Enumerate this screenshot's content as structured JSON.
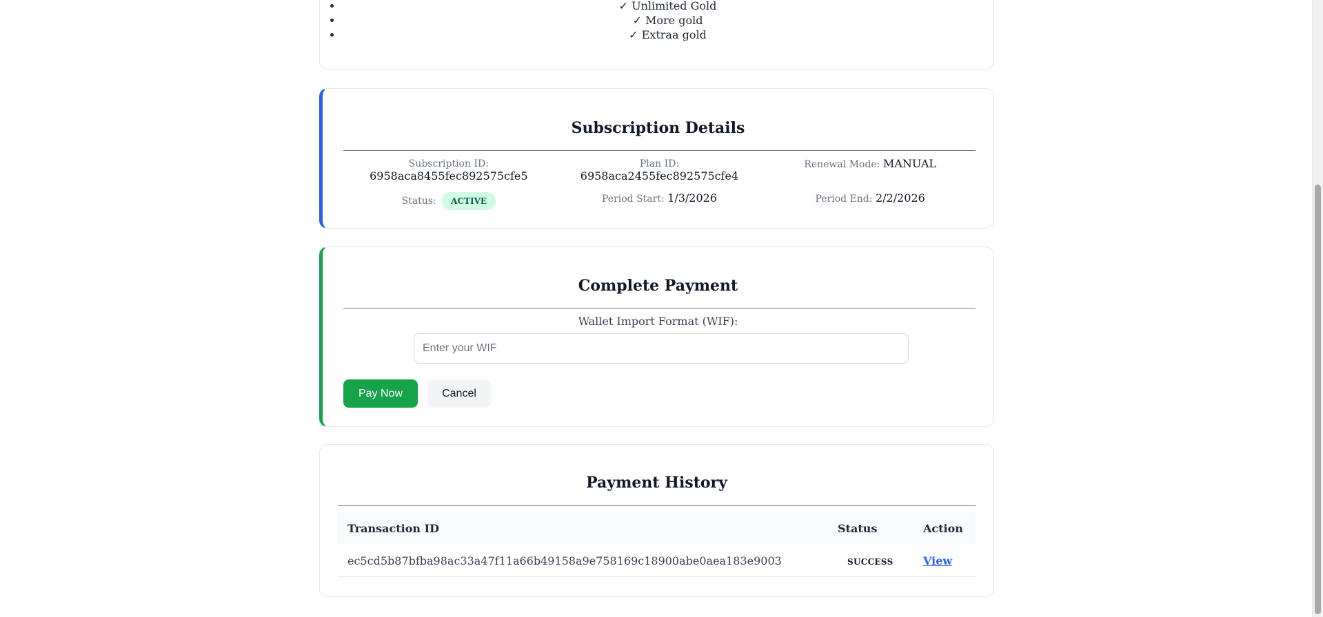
{
  "features": {
    "items": [
      "✓ Unlimited Gold",
      "✓ More gold",
      "✓ Extraa gold"
    ]
  },
  "subscription": {
    "title": "Subscription Details",
    "subscription_id_label": "Subscription ID:",
    "subscription_id": "6958aca8455fec892575cfe5",
    "plan_id_label": "Plan ID:",
    "plan_id": "6958aca2455fec892575cfe4",
    "renewal_label": "Renewal Mode:",
    "renewal_mode": "MANUAL",
    "status_label": "Status:",
    "status": "ACTIVE",
    "period_start_label": "Period Start:",
    "period_start": "1/3/2026",
    "period_end_label": "Period End:",
    "period_end": "2/2/2026"
  },
  "payment": {
    "title": "Complete Payment",
    "wif_label": "Wallet Import Format (WIF):",
    "wif_placeholder": "Enter your WIF",
    "wif_value": "",
    "pay_label": "Pay Now",
    "cancel_label": "Cancel"
  },
  "history": {
    "title": "Payment History",
    "columns": [
      "Transaction ID",
      "Status",
      "Action"
    ],
    "rows": [
      {
        "transaction_id": "ec5cd5b87bfba98ac33a47f11a66b49158a9e758169c18900abe0aea183e9003",
        "status": "SUCCESS",
        "action": "View"
      }
    ]
  },
  "colors": {
    "accent_blue": "#2563eb",
    "accent_green": "#16a34a",
    "status_active_bg": "#d1fae5",
    "link": "#2563eb"
  }
}
